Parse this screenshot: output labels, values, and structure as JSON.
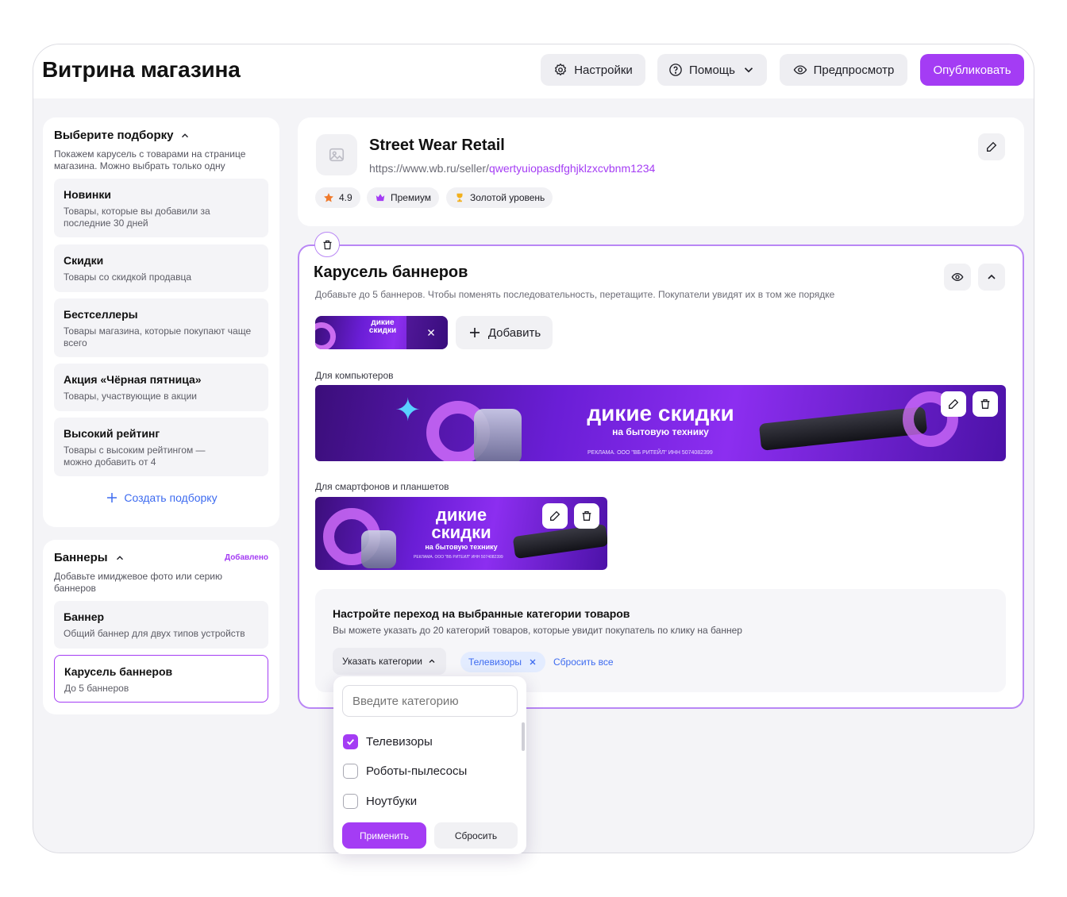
{
  "header": {
    "title": "Витрина магазина",
    "settings_label": "Настройки",
    "help_label": "Помощь",
    "preview_label": "Предпросмотр",
    "publish_label": "Опубликовать"
  },
  "collection": {
    "title": "Выберите подборку",
    "description": "Покажем карусель с товарами на странице магазина. Можно выбрать только одну",
    "options": [
      {
        "title": "Новинки",
        "desc": "Товары, которые вы добавили за последние 30 дней"
      },
      {
        "title": "Скидки",
        "desc": "Товары со скидкой продавца"
      },
      {
        "title": "Бестселлеры",
        "desc": "Товары магазина, которые покупают чаще всего"
      },
      {
        "title": "Акция «Чёрная пятница»",
        "desc": "Товары, участвующие в акции"
      },
      {
        "title": "Высокий рейтинг",
        "desc": "Товары с высоким рейтингом — можно добавить от 4"
      }
    ],
    "create_label": "Создать подборку"
  },
  "banners": {
    "title": "Баннеры",
    "status": "Добавлено",
    "description": "Добавьте имиджевое фото или серию баннеров",
    "options": [
      {
        "title": "Баннер",
        "desc": "Общий баннер для двух типов устройств"
      },
      {
        "title": "Карусель баннеров",
        "desc": "До 5 баннеров"
      }
    ]
  },
  "store": {
    "name": "Street Wear Retail",
    "url_prefix": "https://www.wb.ru/seller/",
    "url_slug": "qwertyuiopasdfghjklzxcvbnm1234",
    "rating": "4.9",
    "badge_premium": "Премиум",
    "badge_gold": "Золотой уровень"
  },
  "carousel": {
    "title": "Карусель баннеров",
    "description": "Добавьте до 5 баннеров. Чтобы поменять последовательность, перетащите. Покупатели увидят их в том же порядке",
    "add_label": "Добавить",
    "desktop_label": "Для компьютеров",
    "mobile_label": "Для смартфонов и планшетов",
    "banner_title": "дикие скидки",
    "banner_title_line1": "дикие",
    "banner_title_line2": "скидки",
    "banner_subtitle": "на бытовую технику",
    "banner_legal": "РЕКЛАМА. ООО \"ВБ РИТЕЙЛ\" ИНН 5074082399",
    "thumb_title_line1": "дикие",
    "thumb_title_line2": "скидки"
  },
  "categories": {
    "title": "Настройте переход на выбранные категории товаров",
    "description": "Вы можете указать до 20 категорий товаров, которые увидит покупатель по клику на баннер",
    "select_label": "Указать категории",
    "selected_tag": "Телевизоры",
    "reset_all": "Сбросить все",
    "search_placeholder": "Введите категорию",
    "items": [
      {
        "label": "Телевизоры",
        "checked": true
      },
      {
        "label": "Роботы-пылесосы",
        "checked": false
      },
      {
        "label": "Ноутбуки",
        "checked": false
      }
    ],
    "apply_label": "Применить",
    "reset_label": "Сбросить"
  },
  "colors": {
    "accent": "#a43cf4",
    "link": "#3d6bf0",
    "background": "#f4f4f7"
  }
}
